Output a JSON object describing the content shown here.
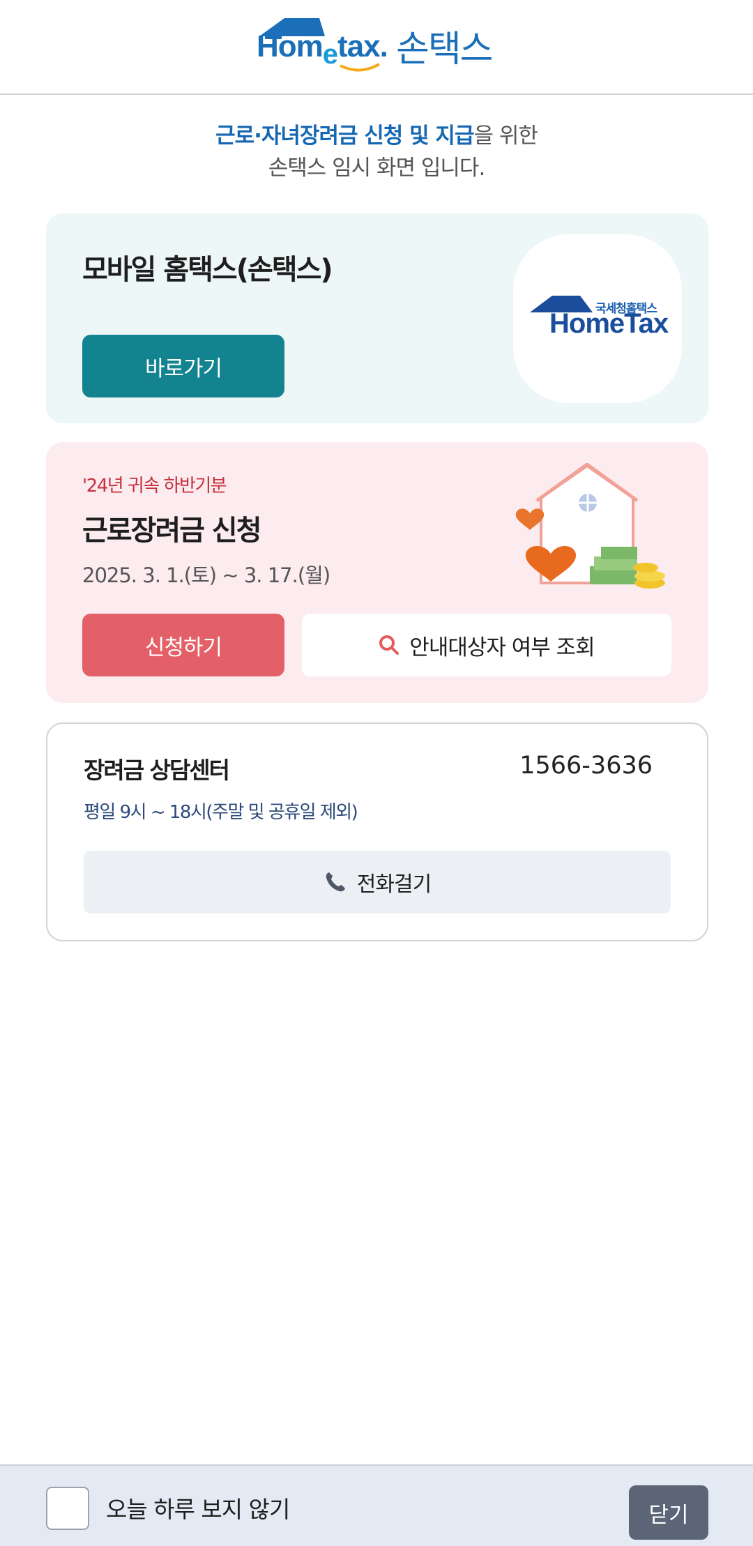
{
  "header": {
    "logo_brand": "Hometax.",
    "logo_brand_parts": [
      "Hom",
      "e",
      "tax."
    ],
    "logo_korean": "손택스"
  },
  "intro": {
    "highlight": "근로·자녀장려금 신청 및 지급",
    "line1_rest": "을 위한",
    "line2": "손택스 임시 화면 입니다."
  },
  "mobile_card": {
    "title": "모바일 홈택스(손택스)",
    "button_label": "바로가기",
    "app_icon_sub": "국세청홈택스",
    "app_icon_name": "HomeTax",
    "bg_color": "#edf7f7",
    "button_color": "#12838f"
  },
  "apply_card": {
    "period": "'24년 귀속 하반기분",
    "title": "근로장려금 신청",
    "dates": "2025. 3. 1.(토) ~ 3. 17.(월)",
    "apply_button": "신청하기",
    "lookup_button": "안내대상자 여부 조회",
    "bg_color": "#fdecef",
    "apply_button_color": "#e46068"
  },
  "center_card": {
    "title": "장려금 상담센터",
    "phone": "1566-3636",
    "hours": "평일 9시 ~ 18시(주말 및 공휴일 제외)",
    "call_button": "전화걸기"
  },
  "footer": {
    "checkbox_label": "오늘 하루 보지 않기",
    "close_button": "닫기",
    "checkbox_checked": false
  },
  "icons": {
    "lookup": "search-icon",
    "call": "phone-icon"
  }
}
